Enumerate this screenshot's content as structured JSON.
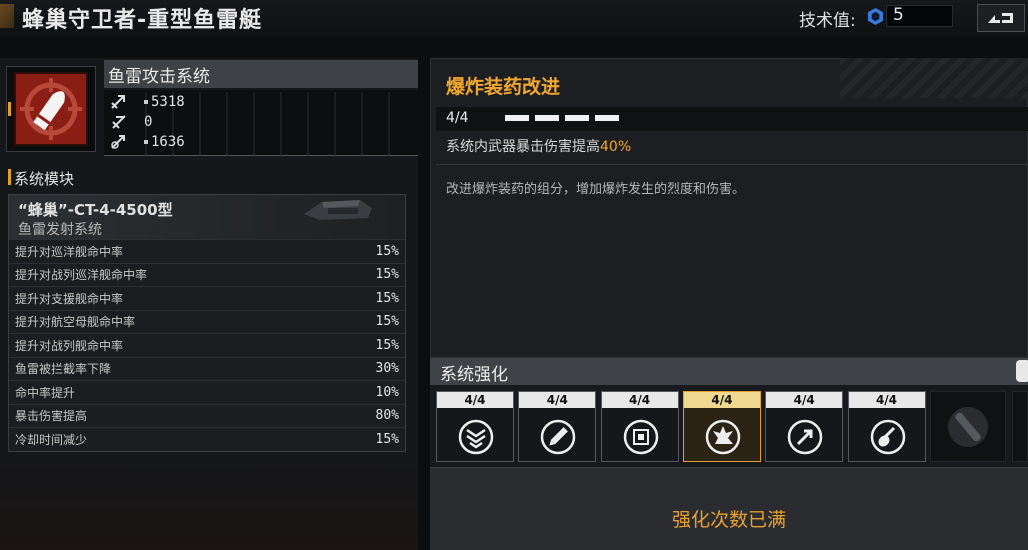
{
  "header": {
    "title": "蜂巢守卫者-重型鱼雷艇",
    "tech_label": "技术值:",
    "tech_value": "5",
    "back_icon": "back-arrow-icon"
  },
  "system": {
    "name": "鱼雷攻击系统",
    "icon": "torpedo-icon",
    "stats": [
      {
        "icon": "attack-icon",
        "value": "5318",
        "dot": true
      },
      {
        "icon": "speed-icon",
        "value": "0",
        "dot": false
      },
      {
        "icon": "range-icon",
        "value": "1636",
        "dot": true
      }
    ]
  },
  "modules": {
    "label": "系统模块",
    "title": "“蜂巢”-CT-4-4500型",
    "subtitle": "鱼雷发射系统",
    "rows": [
      {
        "name": "提升对巡洋舰命中率",
        "value": "15%"
      },
      {
        "name": "提升对战列巡洋舰命中率",
        "value": "15%"
      },
      {
        "name": "提升对支援舰命中率",
        "value": "15%"
      },
      {
        "name": "提升对航空母舰命中率",
        "value": "15%"
      },
      {
        "name": "提升对战列舰命中率",
        "value": "15%"
      },
      {
        "name": "鱼雷被拦截率下降",
        "value": "30%"
      },
      {
        "name": "命中率提升",
        "value": "10%"
      },
      {
        "name": "暴击伤害提高",
        "value": "80%"
      },
      {
        "name": "冷却时间减少",
        "value": "15%"
      }
    ]
  },
  "upgrade": {
    "title": "爆炸装药改进",
    "level": "4/4",
    "level_fraction": 1.0,
    "desc_prefix": "系统内武器暴击伤害提高",
    "desc_value": "40%",
    "flavor": "改进爆炸装药的组分，增加爆炸发生的烈度和伤害。"
  },
  "enhancement": {
    "label": "系统强化",
    "cards": [
      {
        "level": "4/4",
        "icon": "rank-chevron-icon",
        "selected": false
      },
      {
        "level": "4/4",
        "icon": "pen-icon",
        "selected": false
      },
      {
        "level": "4/4",
        "icon": "chip-icon",
        "selected": false
      },
      {
        "level": "4/4",
        "icon": "explosion-icon",
        "selected": true
      },
      {
        "level": "4/4",
        "icon": "shield-arrow-icon",
        "selected": false
      },
      {
        "level": "4/4",
        "icon": "guitar-icon",
        "selected": false
      }
    ],
    "locked_icon": "missile-locked-icon",
    "maxed_text": "强化次数已满"
  },
  "colors": {
    "accent": "#f0a830",
    "selected": "#e6a030",
    "torpedo_bg": "#8a1e14"
  }
}
